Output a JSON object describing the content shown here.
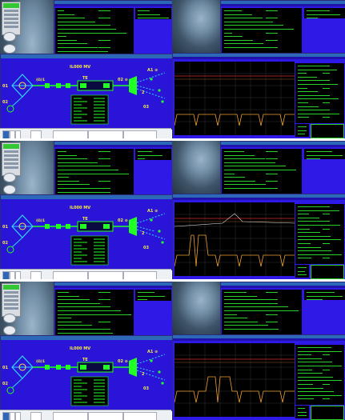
{
  "panels": [
    {
      "id": "top",
      "caption": "",
      "diagram": {
        "title": "IL000 MV",
        "left_label_1": "01",
        "left_label_2": "02",
        "left_mid": "(Ω)1",
        "trafo": "TE",
        "right_top": "A1 ⊙",
        "right_mid": "02 ⊙",
        "right_bottom": "03",
        "right_num": "2"
      }
    },
    {
      "id": "mid",
      "caption": "",
      "diagram": {
        "title": "IL000 MV",
        "left_label_1": "01",
        "left_label_2": "02",
        "left_mid": "(Ω)1",
        "trafo": "TE",
        "right_top": "A1 ⊙",
        "right_mid": "02 ⊙",
        "right_bottom": "03",
        "right_num": "2"
      }
    },
    {
      "id": "bot",
      "caption": "",
      "diagram": {
        "title": "IL000 MV",
        "left_label_1": "01",
        "left_label_2": "02",
        "left_mid": "(Ω)1",
        "trafo": "TE",
        "right_top": "A1 ⊙",
        "right_mid": "02 ⊙",
        "right_bottom": "03",
        "right_num": "2"
      }
    }
  ],
  "colors": {
    "desktop_accent": "#34c634",
    "window_bg": "#2f19e6",
    "terminal_fg": "#2bd12b",
    "plot_red": "#d22a2a",
    "plot_orange": "#f0a030",
    "diagram_green": "#22ff22",
    "diagram_yellow": "#f4e842",
    "diagram_cyan": "#30d8ff"
  },
  "icons": [
    "desktop-shortcut-icon",
    "start-menu-icon",
    "terminal-window-icon",
    "transformer-icon",
    "breaker-icon"
  ]
}
